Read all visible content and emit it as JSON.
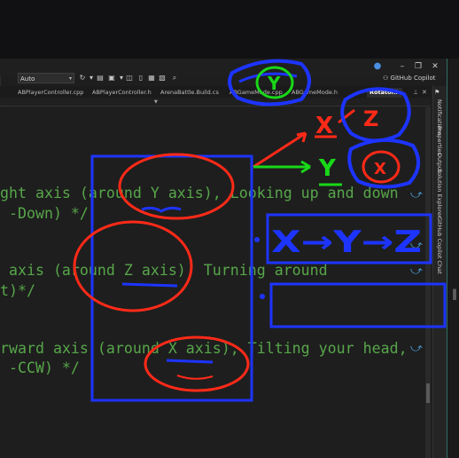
{
  "toolbar": {
    "config_value": "Auto",
    "icons": [
      "refresh-icon",
      "new-item-icon",
      "save-icon",
      "debug-icon",
      "bookmark-icon",
      "solution-icon",
      "layout-icon",
      "search-icon"
    ],
    "copilot_label": "GitHub Copilot"
  },
  "window_controls": [
    "minimize-icon",
    "restore-icon",
    "close-icon"
  ],
  "tabs": [
    {
      "label": "ABPlayerController.cpp",
      "active": false
    },
    {
      "label": "ABPlayerController.h",
      "active": false
    },
    {
      "label": "ArenaBattle.Build.cs",
      "active": false
    },
    {
      "label": "ABGameMode.cpp",
      "active": false
    },
    {
      "label": "ABGameMode.h",
      "active": false
    },
    {
      "label": "Rotator.h",
      "active": true
    }
  ],
  "side_panel": {
    "labels": [
      "Notifications",
      "Properties",
      "Output",
      "Solution Explorer",
      "GitHub Copilot Chat"
    ]
  },
  "code_lines": [
    "ght axis (around Y axis), Looking up and down",
    " -Down) */",
    " axis (around Z axis), Turning around",
    "t)*/",
    "rward axis (around X axis), Tilting your head,",
    " -CCW) */"
  ],
  "annotations": {
    "top_letter": "Y",
    "red_letter_1": "X",
    "red_letter_2": "Z",
    "green_letter": "Y",
    "red_letter_3": "X",
    "sequence": "X→Y→Z",
    "colors": {
      "blue": "#1d34ff",
      "red": "#ff2a18",
      "green": "#18d818"
    }
  }
}
